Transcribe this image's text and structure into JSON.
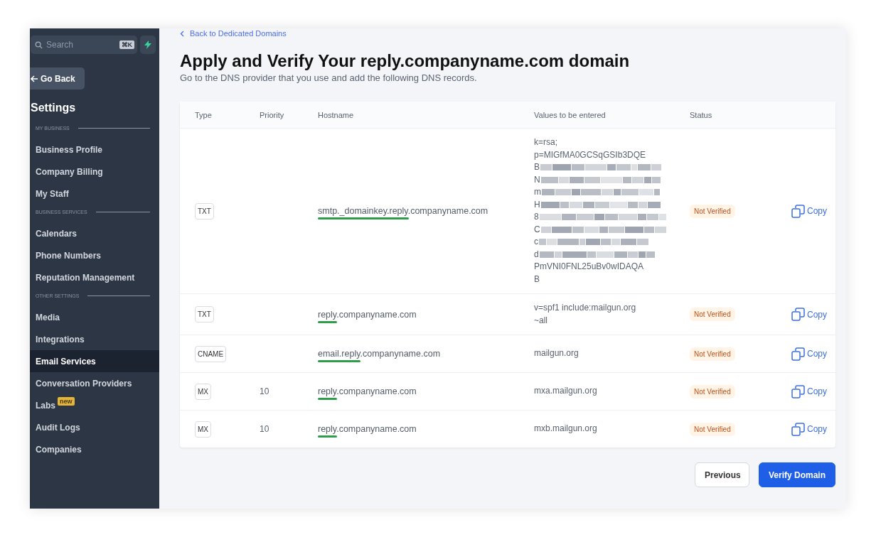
{
  "sidebar": {
    "search": {
      "placeholder": "Search",
      "shortcut": "⌘K"
    },
    "back_button": "Go Back",
    "title": "Settings",
    "sections": [
      {
        "heading": "MY BUSINESS",
        "items": [
          {
            "label": "Business Profile",
            "selected": false
          },
          {
            "label": "Company Billing",
            "selected": false
          },
          {
            "label": "My Staff",
            "selected": false
          }
        ]
      },
      {
        "heading": "BUSINESS SERVICES",
        "items": [
          {
            "label": "Calendars",
            "selected": false
          },
          {
            "label": "Phone Numbers",
            "selected": false
          },
          {
            "label": "Reputation Management",
            "selected": false
          }
        ]
      },
      {
        "heading": "OTHER SETTINGS",
        "items": [
          {
            "label": "Media",
            "selected": false
          },
          {
            "label": "Integrations",
            "selected": false
          },
          {
            "label": "Email Services",
            "selected": true
          },
          {
            "label": "Conversation Providers",
            "selected": false
          },
          {
            "label": "Labs",
            "selected": false,
            "badge": "new"
          },
          {
            "label": "Audit Logs",
            "selected": false
          },
          {
            "label": "Companies",
            "selected": false
          }
        ]
      }
    ]
  },
  "main": {
    "back_link": "Back to Dedicated Domains",
    "title": "Apply and Verify Your reply.companyname.com domain",
    "subtitle": "Go to the DNS provider that you use and add the following DNS records.",
    "table": {
      "columns": [
        "Type",
        "Priority",
        "Hostname",
        "Values to be entered",
        "Status"
      ],
      "rows": [
        {
          "type": "TXT",
          "hostname_marked": "smtp._domainkey.reply",
          "hostname_rest": ".companyname.com",
          "value_lines": [
            {
              "kind": "text",
              "text": "k=rsa;"
            },
            {
              "kind": "text",
              "text": "p=MIGfMA0GCSqGSIb3DQE"
            },
            {
              "kind": "redacted",
              "text": "B"
            },
            {
              "kind": "redacted",
              "text": "N"
            },
            {
              "kind": "redacted",
              "text": "m"
            },
            {
              "kind": "redacted",
              "text": "H"
            },
            {
              "kind": "redacted",
              "text": "8"
            },
            {
              "kind": "redacted",
              "text": "C"
            },
            {
              "kind": "redacted",
              "text": "c"
            },
            {
              "kind": "redacted",
              "text": "d"
            },
            {
              "kind": "text",
              "text": "PmVNI0FNL25uBv0wIDAQA"
            },
            {
              "kind": "text",
              "text": "B"
            }
          ],
          "status": "Not Verified",
          "action": "Copy"
        },
        {
          "type": "TXT",
          "hostname_marked": "reply",
          "hostname_rest": ".companyname.com",
          "value_lines": [
            {
              "kind": "text",
              "text": "v=spf1 include:mailgun.org"
            },
            {
              "kind": "text",
              "text": "~all"
            }
          ],
          "status": "Not Verified",
          "action": "Copy"
        },
        {
          "type": "CNAME",
          "hostname_marked": "email.reply",
          "hostname_rest": ".companyname.com",
          "value_lines": [
            {
              "kind": "text",
              "text": "mailgun.org"
            }
          ],
          "status": "Not Verified",
          "action": "Copy"
        },
        {
          "type": "MX",
          "priority": "10",
          "hostname_marked": "reply",
          "hostname_rest": ".companyname.com",
          "value_lines": [
            {
              "kind": "text",
              "text": "mxa.mailgun.org"
            }
          ],
          "status": "Not Verified",
          "action": "Copy"
        },
        {
          "type": "MX",
          "priority": "10",
          "hostname_marked": "reply",
          "hostname_rest": ".companyname.com",
          "value_lines": [
            {
              "kind": "text",
              "text": "mxb.mailgun.org"
            }
          ],
          "status": "Not Verified",
          "action": "Copy"
        }
      ]
    },
    "buttons": [
      {
        "label": "Previous",
        "kind": "secondary"
      },
      {
        "label": "Verify Domain",
        "kind": "primary"
      }
    ]
  }
}
